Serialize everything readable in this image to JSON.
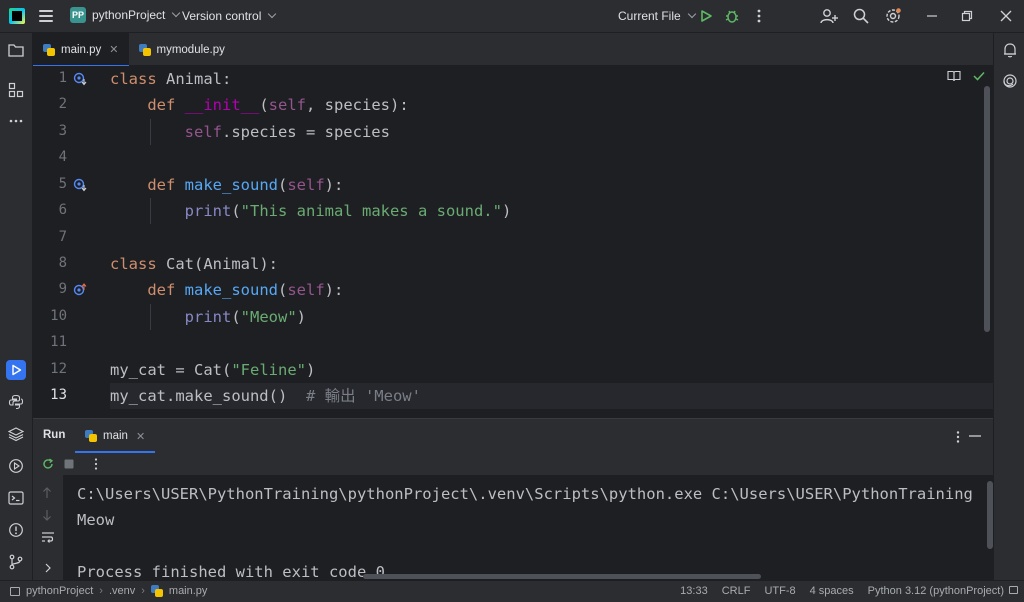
{
  "titlebar": {
    "project_badge": "PP",
    "project_name": "pythonProject",
    "version_control": "Version control",
    "run_config": "Current File"
  },
  "tabs": [
    {
      "label": "main.py",
      "active": true
    },
    {
      "label": "mymodule.py",
      "active": false
    }
  ],
  "editor": {
    "lines": [
      "1",
      "2",
      "3",
      "4",
      "5",
      "6",
      "7",
      "8",
      "9",
      "10",
      "11",
      "12",
      "13"
    ],
    "current_line": "13"
  },
  "run_panel": {
    "title": "Run",
    "tab_label": "main",
    "console": [
      "C:\\Users\\USER\\PythonTraining\\pythonProject\\.venv\\Scripts\\python.exe C:\\Users\\USER\\PythonTraining",
      "Meow",
      "",
      "Process finished with exit code 0"
    ]
  },
  "statusbar": {
    "breadcrumb": [
      "pythonProject",
      ".venv",
      "main.py"
    ],
    "position": "13:33",
    "line_sep": "CRLF",
    "encoding": "UTF-8",
    "indent": "4 spaces",
    "interpreter": "Python 3.12 (pythonProject)"
  },
  "colors": {
    "accent": "#3574f0",
    "background": "#1e1f22",
    "panel": "#2b2d30",
    "run_green": "#5fb865"
  }
}
